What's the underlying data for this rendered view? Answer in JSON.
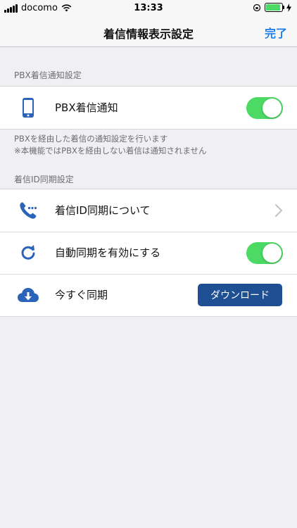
{
  "status_bar": {
    "carrier": "docomo",
    "time": "13:33"
  },
  "nav": {
    "title": "着信情報表示設定",
    "done_label": "完了"
  },
  "sections": {
    "pbx": {
      "header": "PBX着信通知設定",
      "row_label": "PBX着信通知",
      "toggle_on": true,
      "note_line1": "PBXを経由した着信の通知設定を行います",
      "note_line2": "※本機能ではPBXを経由しない着信は通知されません"
    },
    "caller_id": {
      "header": "着信ID同期設定",
      "about_label": "着信ID同期について",
      "auto_sync_label": "自動同期を有効にする",
      "auto_sync_on": true,
      "sync_now_label": "今すぐ同期",
      "download_label": "ダウンロード"
    }
  },
  "colors": {
    "accent": "#1a7ef0",
    "icon_blue": "#2a63b8",
    "toggle_on": "#4cd964",
    "button": "#1f4f93"
  },
  "icons": {
    "pbx": "smartphone-icon",
    "about": "phone-dots-icon",
    "auto_sync": "refresh-icon",
    "sync_now": "cloud-download-icon"
  }
}
